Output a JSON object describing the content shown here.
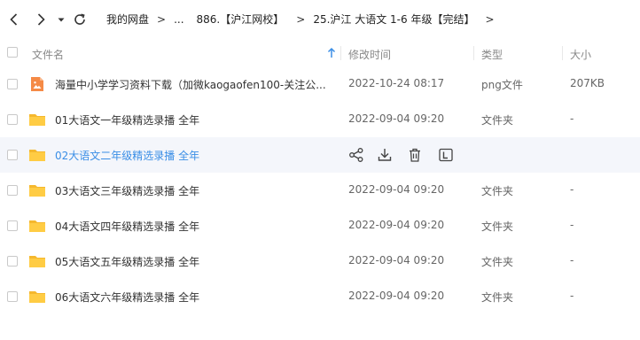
{
  "breadcrumb": {
    "root": "我的网盘",
    "ellipsis": "...",
    "level1": "886.【沪江网校】",
    "level2": "25.沪江 大语文 1-6 年级【完结】"
  },
  "columns": {
    "name": "文件名",
    "modified": "修改时间",
    "type": "类型",
    "size": "大小"
  },
  "files": [
    {
      "name": "海量中小学学习资料下载（加微kaogaofen100-关注公...",
      "modified": "2022-10-24 08:17",
      "type": "png文件",
      "size": "207KB",
      "icon": "image-file-icon"
    },
    {
      "name": "01大语文一年级精选录播 全年",
      "modified": "2022-09-04 09:20",
      "type": "文件夹",
      "size": "-",
      "icon": "folder-icon"
    },
    {
      "name": "02大语文二年级精选录播 全年",
      "modified": "",
      "type": "",
      "size": "",
      "icon": "folder-icon"
    },
    {
      "name": "03大语文三年级精选录播 全年",
      "modified": "2022-09-04 09:20",
      "type": "文件夹",
      "size": "-",
      "icon": "folder-icon"
    },
    {
      "name": "04大语文四年级精选录播 全年",
      "modified": "2022-09-04 09:20",
      "type": "文件夹",
      "size": "-",
      "icon": "folder-icon"
    },
    {
      "name": "05大语文五年级精选录播 全年",
      "modified": "2022-09-04 09:20",
      "type": "文件夹",
      "size": "-",
      "icon": "folder-icon"
    },
    {
      "name": "06大语文六年级精选录播 全年",
      "modified": "2022-09-04 09:20",
      "type": "文件夹",
      "size": "-",
      "icon": "folder-icon"
    }
  ],
  "hover_actions": [
    "share-icon",
    "download-icon",
    "delete-icon",
    "rename-icon"
  ],
  "colors": {
    "accent": "#3a8ee6",
    "folder": "#ffcc44",
    "image_icon": "#f58a46",
    "hover_row": "#f4f6fb"
  }
}
